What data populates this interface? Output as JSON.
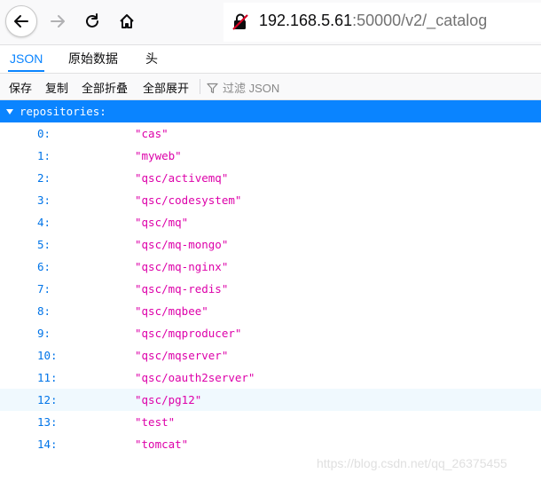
{
  "navbar": {
    "url_host": "192.168.5.61",
    "url_rest": ":50000/v2/_catalog"
  },
  "tabs": [
    {
      "label": "JSON"
    },
    {
      "label": "原始数据"
    },
    {
      "label": "头"
    }
  ],
  "toolbar": {
    "save": "保存",
    "copy": "复制",
    "collapse_all": "全部折叠",
    "expand_all": "全部展开",
    "filter_placeholder": "过滤 JSON"
  },
  "json": {
    "root_key": "repositories:",
    "items": [
      {
        "key": "0:",
        "value": "\"cas\""
      },
      {
        "key": "1:",
        "value": "\"myweb\""
      },
      {
        "key": "2:",
        "value": "\"qsc/activemq\""
      },
      {
        "key": "3:",
        "value": "\"qsc/codesystem\""
      },
      {
        "key": "4:",
        "value": "\"qsc/mq\""
      },
      {
        "key": "5:",
        "value": "\"qsc/mq-mongo\""
      },
      {
        "key": "6:",
        "value": "\"qsc/mq-nginx\""
      },
      {
        "key": "7:",
        "value": "\"qsc/mq-redis\""
      },
      {
        "key": "8:",
        "value": "\"qsc/mqbee\""
      },
      {
        "key": "9:",
        "value": "\"qsc/mqproducer\""
      },
      {
        "key": "10:",
        "value": "\"qsc/mqserver\""
      },
      {
        "key": "11:",
        "value": "\"qsc/oauth2server\""
      },
      {
        "key": "12:",
        "value": "\"qsc/pg12\""
      },
      {
        "key": "13:",
        "value": "\"test\""
      },
      {
        "key": "14:",
        "value": "\"tomcat\""
      }
    ]
  },
  "watermark": "https://blog.csdn.net/qq_26375455"
}
